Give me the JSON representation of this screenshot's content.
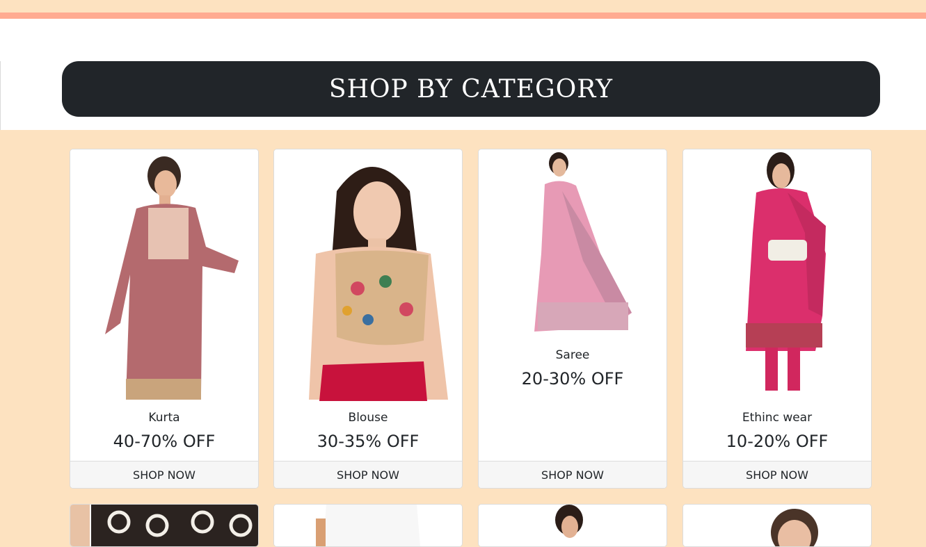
{
  "header": {
    "title": "SHOP BY CATEGORY"
  },
  "categories": [
    {
      "name": "Kurta",
      "offer": "40-70% OFF",
      "cta": "SHOP NOW",
      "image": "kurta-model-image"
    },
    {
      "name": "Blouse",
      "offer": "30-35% OFF",
      "cta": "SHOP NOW",
      "image": "blouse-model-image"
    },
    {
      "name": "Saree",
      "offer": "20-30% OFF",
      "cta": "SHOP NOW",
      "image": "saree-model-image"
    },
    {
      "name": "Ethinc wear",
      "offer": "10-20% OFF",
      "cta": "SHOP NOW",
      "image": "ethnic-wear-model-image"
    }
  ],
  "colors": {
    "page_bg": "#fde2c0",
    "accent_line": "#ffab91",
    "banner_bg": "#212529",
    "card_footer_bg": "#f6f6f6"
  }
}
